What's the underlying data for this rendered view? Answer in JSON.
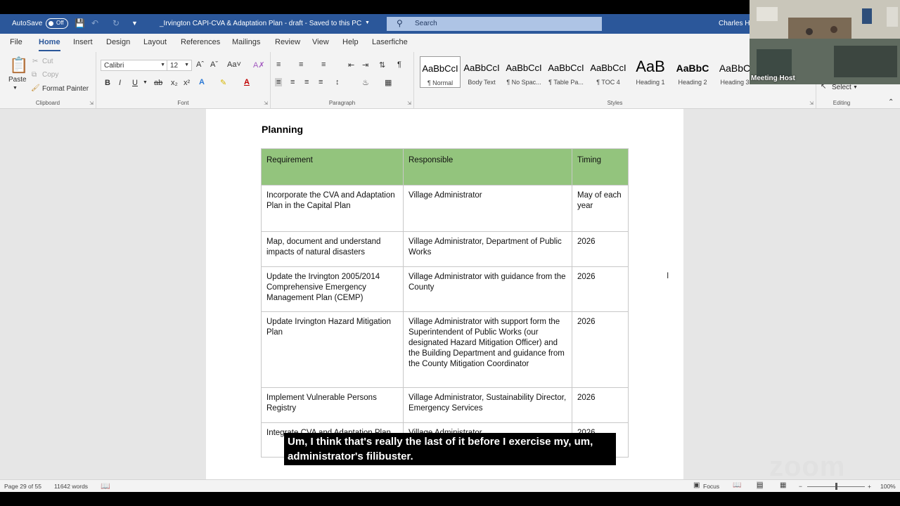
{
  "titlebar": {
    "autosave": "AutoSave",
    "toggle_state": "Off",
    "doc_title": "_Irvington CAPI-CVA & Adaptation Plan - draft  -  Saved to this PC",
    "search_placeholder": "Search",
    "user": "Charles H"
  },
  "tabs": [
    "File",
    "Home",
    "Insert",
    "Design",
    "Layout",
    "References",
    "Mailings",
    "Review",
    "View",
    "Help",
    "Laserfiche"
  ],
  "active_tab": "Home",
  "ribbon": {
    "clipboard": {
      "paste": "Paste",
      "cut": "Cut",
      "copy": "Copy",
      "format_painter": "Format Painter",
      "label": "Clipboard"
    },
    "font": {
      "name": "Calibri",
      "size": "12",
      "label": "Font"
    },
    "paragraph": {
      "label": "Paragraph"
    },
    "styles": {
      "label": "Styles",
      "items": [
        {
          "sample": "AaBbCcI",
          "name": "¶ Normal"
        },
        {
          "sample": "AaBbCcI",
          "name": "Body Text"
        },
        {
          "sample": "AaBbCcI",
          "name": "¶ No Spac..."
        },
        {
          "sample": "AaBbCcI",
          "name": "¶ Table Pa..."
        },
        {
          "sample": "AaBbCcI",
          "name": "¶ TOC 4"
        },
        {
          "sample": "AaB",
          "name": "Heading 1"
        },
        {
          "sample": "AaBbC",
          "name": "Heading 2"
        },
        {
          "sample": "AaBbC",
          "name": "Heading 3"
        }
      ]
    },
    "editing": {
      "select": "Select",
      "label": "Editing"
    }
  },
  "document": {
    "heading": "Planning",
    "table_headers": [
      "Requirement",
      "Responsible",
      "Timing"
    ],
    "rows": [
      [
        "Incorporate the CVA and Adaptation Plan in the Capital Plan",
        "Village Administrator",
        "May of each year"
      ],
      [
        "Map, document and understand impacts of natural disasters",
        "Village Administrator, Department of Public Works",
        "2026"
      ],
      [
        "Update the Irvington 2005/2014 Comprehensive Emergency Management Plan (CEMP)",
        "Village Administrator with guidance from the County",
        "2026"
      ],
      [
        "Update Irvington Hazard Mitigation Plan",
        "Village Administrator with support form the Superintendent of Public Works (our designated Hazard Mitigation Officer) and the Building Department and guidance from the County Mitigation Coordinator",
        "2026"
      ],
      [
        "Implement Vulnerable Persons Registry",
        "Village Administrator, Sustainability Director, Emergency Services",
        "2026"
      ],
      [
        "Integrate CVA and Adaptation Plan",
        "Village Administrator",
        "2026"
      ]
    ]
  },
  "caption": "Um, I think that's really the last of it before I exercise my, um, administrator's filibuster.",
  "status": {
    "page": "Page 29 of 55",
    "words": "11642 words",
    "focus": "Focus",
    "zoom": "100%"
  },
  "video": {
    "label": "Meeting Host"
  },
  "watermark": "zoom",
  "colors": {
    "title_bar": "#2b579a",
    "table_header": "#93c47d"
  }
}
